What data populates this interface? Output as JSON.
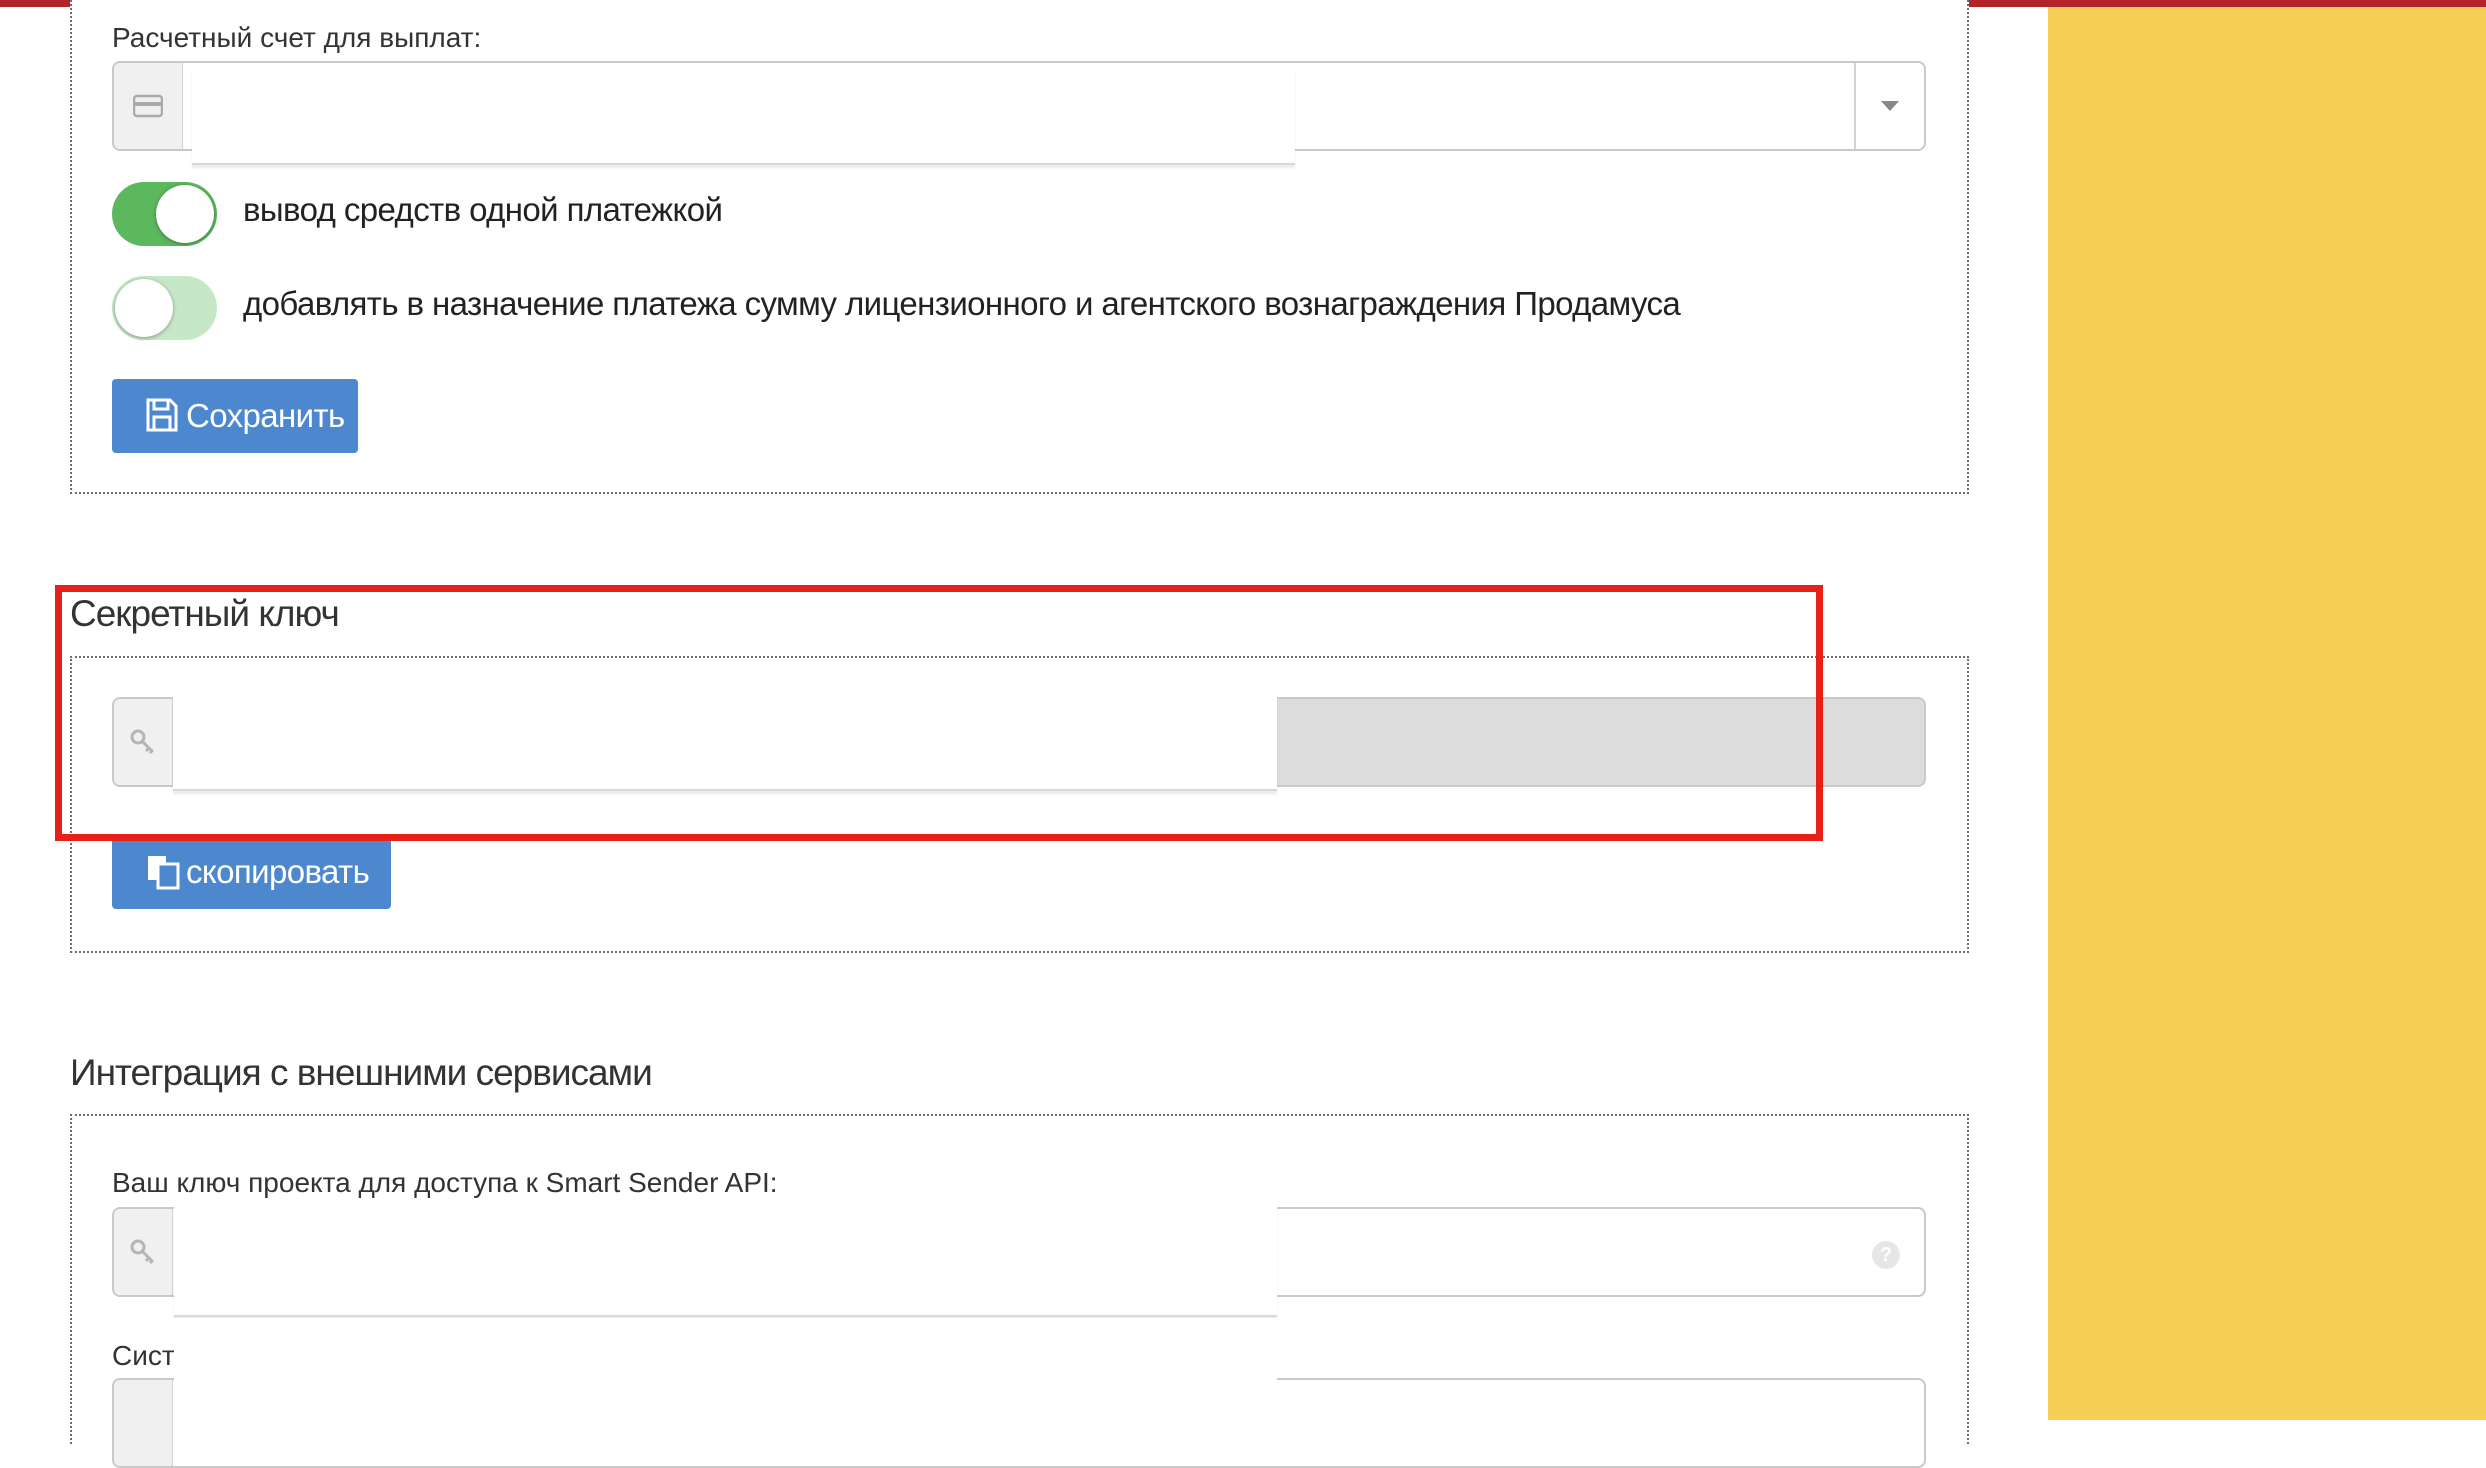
{
  "payout_section": {
    "account_label": "Расчетный счет для выплат:",
    "toggle_single_payment": {
      "label": "вывод средств одной платежкой",
      "on": true
    },
    "toggle_add_commission": {
      "label": "добавлять в назначение платежа сумму лицензионного и агентского вознаграждения Продамуса",
      "on": false
    },
    "save_label": "Сохранить"
  },
  "secret_section": {
    "title": "Секретный ключ",
    "copy_label": "скопировать"
  },
  "integration_section": {
    "title": "Интеграция с внешними сервисами",
    "smart_sender_label": "Ваш ключ проекта для доступа к Smart Sender API:",
    "next_label": "Сист"
  },
  "colors": {
    "accent_button": "#4d88cf",
    "toggle_on": "#5cb85c",
    "toggle_off": "#c7e8c7",
    "highlight": "#e8201a",
    "side_panel": "#f8cf55",
    "top_strip": "#b3232a"
  },
  "icons": {
    "account_addon": "credit-card-icon",
    "save_button": "floppy-disk-icon",
    "key_addon": "key-icon",
    "copy_button": "copy-icon",
    "dropdown": "chevron-down-icon",
    "help": "question-circle-icon"
  }
}
